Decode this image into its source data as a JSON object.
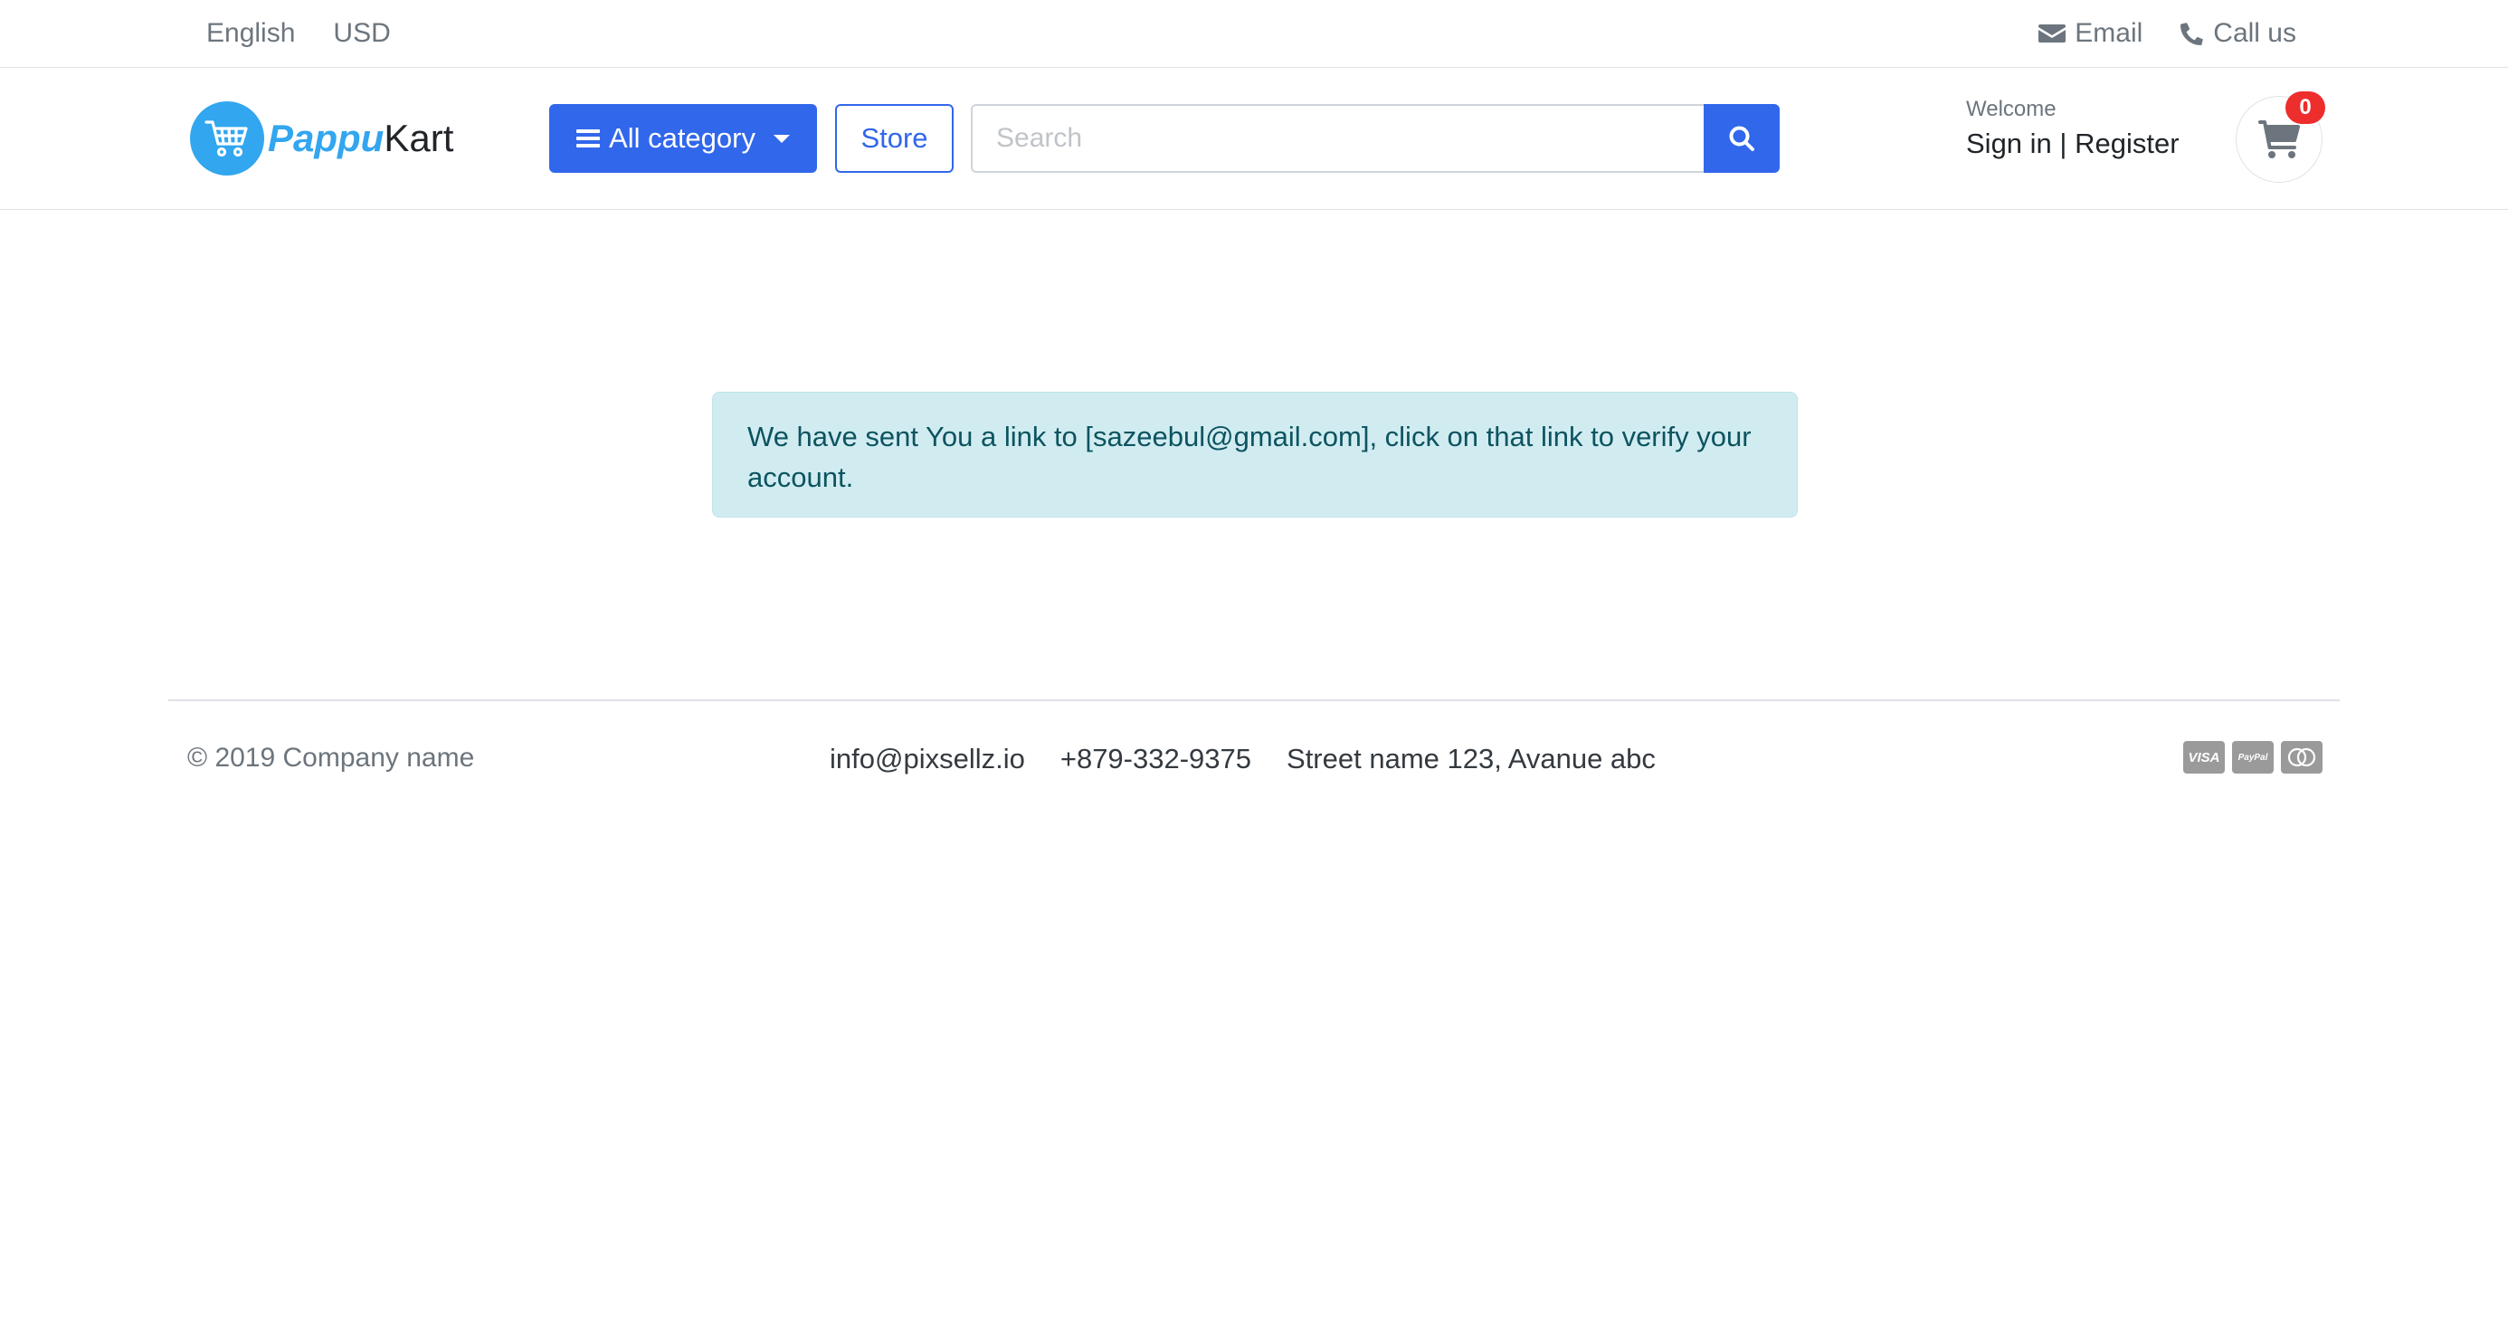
{
  "topbar": {
    "language": "English",
    "currency": "USD",
    "email_label": "Email",
    "call_label": "Call us"
  },
  "header": {
    "logo_part1": "Pappu",
    "logo_part2": "Kart",
    "category_label": "All category",
    "store_label": "Store",
    "search_placeholder": "Search",
    "welcome": "Welcome",
    "sign_in": "Sign in",
    "separator": "|",
    "register": "Register",
    "cart_count": "0"
  },
  "alert": {
    "message": "We have sent You a link to [sazeebul@gmail.com], click on that link to verify your account."
  },
  "footer": {
    "copyright": "© 2019 Company name",
    "email": "info@pixsellz.io",
    "phone": "+879-332-9375",
    "address": "Street name 123, Avanue abc",
    "payments": [
      "VISA",
      "PayPal",
      "MasterCard"
    ]
  },
  "colors": {
    "primary": "#3167eb",
    "logo_blue": "#32a6ef",
    "alert_bg": "#d1ecf1",
    "alert_text": "#0c5460",
    "badge_red": "#ee2d2d"
  },
  "icons": [
    "cart-logo-icon",
    "envelope-icon",
    "phone-icon",
    "bars-icon",
    "search-icon",
    "shopping-cart-icon",
    "visa-icon",
    "paypal-icon",
    "mastercard-icon"
  ]
}
